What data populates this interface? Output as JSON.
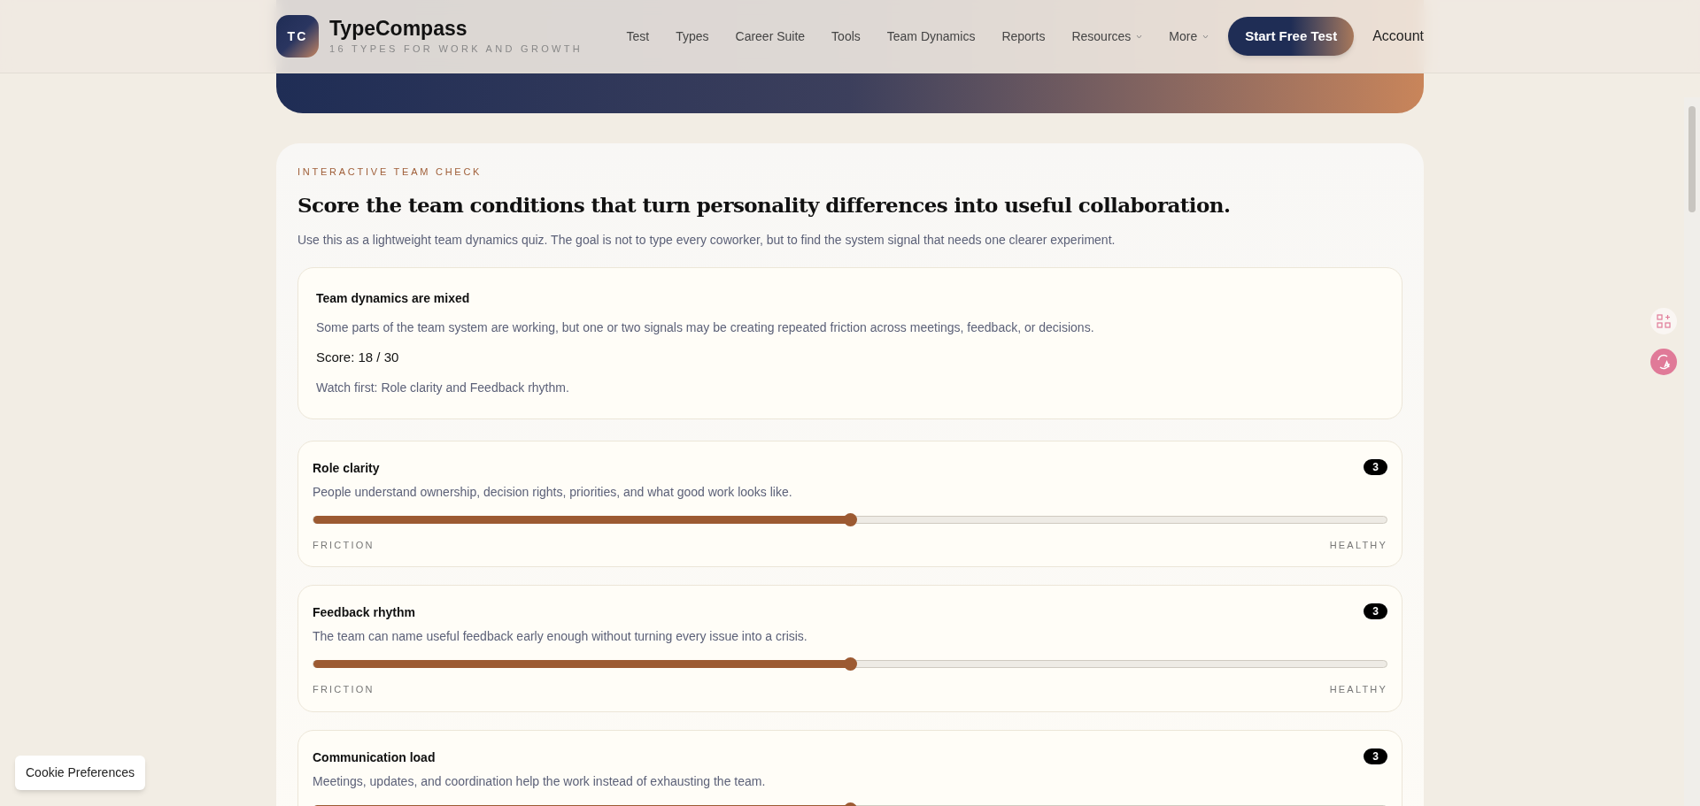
{
  "header": {
    "logo": "TC",
    "brand": "TypeCompass",
    "tagline": "16 TYPES FOR WORK AND GROWTH",
    "nav": [
      {
        "label": "Test",
        "dropdown": false
      },
      {
        "label": "Types",
        "dropdown": false
      },
      {
        "label": "Career Suite",
        "dropdown": false
      },
      {
        "label": "Tools",
        "dropdown": false
      },
      {
        "label": "Team Dynamics",
        "dropdown": false
      },
      {
        "label": "Reports",
        "dropdown": false
      },
      {
        "label": "Resources",
        "dropdown": true
      },
      {
        "label": "More",
        "dropdown": true
      }
    ],
    "cta": "Start Free Test",
    "account": "Account"
  },
  "team_check": {
    "eyebrow": "INTERACTIVE TEAM CHECK",
    "title": "Score the team conditions that turn personality differences into useful collaboration.",
    "intro": "Use this as a lightweight team dynamics quiz. The goal is not to type every coworker, but to find the system signal that needs one clearer experiment.",
    "summary": {
      "heading": "Team dynamics are mixed",
      "text": "Some parts of the team system are working, but one or two signals may be creating repeated friction across meetings, feedback, or decisions.",
      "score": "Score: 18 / 30",
      "watch": "Watch first: Role clarity and Feedback rhythm."
    },
    "factors": [
      {
        "name": "Role clarity",
        "description": "People understand ownership, decision rights, priorities, and what good work looks like.",
        "value": "3",
        "level": 0.5,
        "low": "FRICTION",
        "high": "HEALTHY"
      },
      {
        "name": "Feedback rhythm",
        "description": "The team can name useful feedback early enough without turning every issue into a crisis.",
        "value": "3",
        "level": 0.5,
        "low": "FRICTION",
        "high": "HEALTHY"
      },
      {
        "name": "Communication load",
        "description": "Meetings, updates, and coordination help the work instead of exhausting the team.",
        "value": "3",
        "level": 0.5
      }
    ]
  },
  "cookie_button": "Cookie Preferences"
}
